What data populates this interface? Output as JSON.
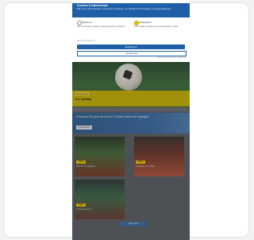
{
  "consent": {
    "title": "Cookies & Datenschutz",
    "body": "Wir und unsere Partner verwenden Cookies, um Inhalte und Anzeigen zu personalisieren.",
    "option_1": {
      "label": "Ablehnen",
      "description": "Nur notwendige Cookies; eingeschränkte Funktionen"
    },
    "option_2": {
      "label": "Akzeptieren",
      "description": "Alle Cookies zulassen für personalisierte Inhalte"
    },
    "info_line": "Mehr Informationen",
    "primary_button": "Zustimmen",
    "secondary_button": "Einstellungen",
    "footer_link": "Datenschutzerklärung · Impressum"
  },
  "hero": {
    "tag": "Bundesliga",
    "title": "Der Spieltag"
  },
  "promo": {
    "text": "Entdecken Sie jetzt die besten Fußball-Videos und Highlights",
    "button": "Jetzt ansehen"
  },
  "thumbs": [
    {
      "badge": "Video",
      "caption": "Bericht vom Spieltag"
    },
    {
      "badge": "Video",
      "caption": "Highlights des Tages"
    },
    {
      "badge": "Video",
      "caption": "Trainer-Interview"
    }
  ],
  "more_button": "Mehr laden",
  "colors": {
    "brand_blue": "#1f5fa8",
    "accent_yellow": "#f2c200"
  }
}
